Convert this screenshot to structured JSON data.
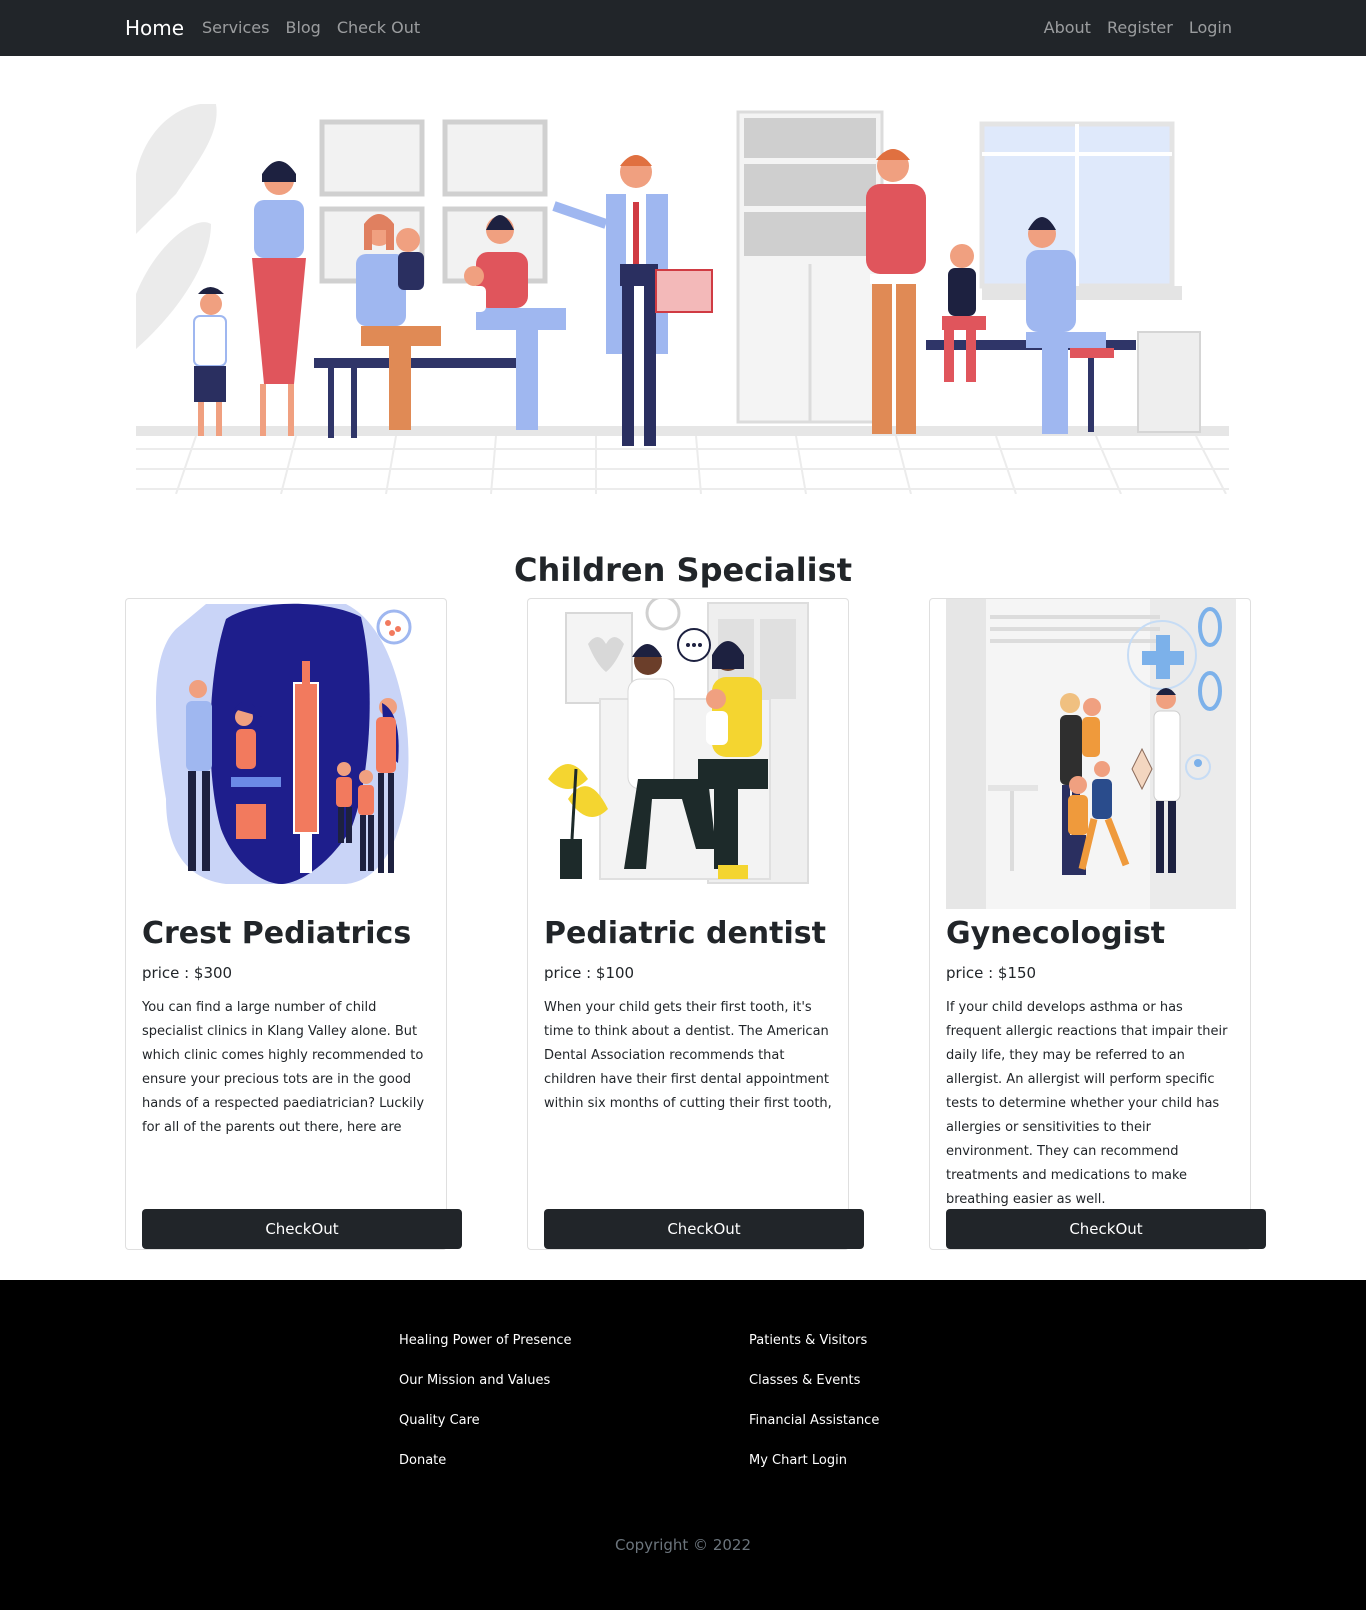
{
  "navbar": {
    "brand": "Home",
    "left_links": [
      "Services",
      "Blog",
      "Check Out"
    ],
    "right_links": [
      "About",
      "Register",
      "Login"
    ]
  },
  "hero": {
    "image": "pediatric-clinic-illustration"
  },
  "section": {
    "title": "Children Specialist"
  },
  "cards": [
    {
      "title": "Crest Pediatrics",
      "price": "price : $300",
      "text": "You can find a large number of child specialist clinics in Klang Valley alone. But which clinic comes highly recommended to ensure your precious tots are in the good hands of a respected paediatrician? Luckily for all of the parents out there, here are",
      "button": "CheckOut",
      "image": "vaccination-illustration"
    },
    {
      "title": "Pediatric dentist",
      "price": "price : $100",
      "text": "When your child gets their first tooth, it's time to think about a dentist. The American Dental Association recommends that children have their first dental appointment within six months of cutting their first tooth,",
      "button": "CheckOut",
      "image": "doctor-mother-baby-illustration"
    },
    {
      "title": "Gynecologist",
      "price": "price : $150",
      "text": "If your child develops asthma or has frequent allergic reactions that impair their daily life, they may be referred to an allergist. An allergist will perform specific tests to determine whether your child has allergies or sensitivities to their environment. They can recommend treatments and medications to make breathing easier as well.",
      "button": "CheckOut",
      "image": "family-doctor-illustration"
    }
  ],
  "footer": {
    "col1": [
      "Healing Power of Presence",
      "Our Mission and Values",
      "Quality Care",
      "Donate"
    ],
    "col2": [
      "Patients & Visitors",
      "Classes & Events",
      "Financial Assistance",
      "My Chart Login"
    ],
    "copyright": "Copyright © 2022"
  },
  "colors": {
    "navbar": "#212529",
    "footer": "#000000",
    "button": "#212529"
  }
}
